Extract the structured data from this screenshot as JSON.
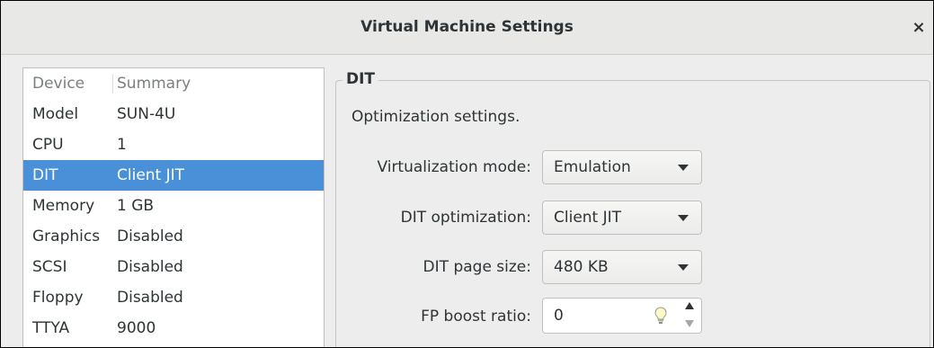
{
  "window": {
    "title": "Virtual Machine Settings",
    "close_glyph": "×"
  },
  "device_list": {
    "headers": {
      "device": "Device",
      "summary": "Summary"
    },
    "rows": [
      {
        "device": "Model",
        "summary": "SUN-4U"
      },
      {
        "device": "CPU",
        "summary": "1"
      },
      {
        "device": "DIT",
        "summary": "Client JIT",
        "selected": true
      },
      {
        "device": "Memory",
        "summary": "1 GB"
      },
      {
        "device": "Graphics",
        "summary": "Disabled"
      },
      {
        "device": "SCSI",
        "summary": "Disabled"
      },
      {
        "device": "Floppy",
        "summary": "Disabled"
      },
      {
        "device": "TTYA",
        "summary": "9000"
      }
    ],
    "selected_color": "#4a90d9"
  },
  "panel": {
    "group_title": "DIT",
    "description": "Optimization settings.",
    "virtualization_mode": {
      "label": "Virtualization mode:",
      "value": "Emulation"
    },
    "dit_optimization": {
      "label": "DIT optimization:",
      "value": "Client JIT"
    },
    "dit_page_size": {
      "label": "DIT page size:",
      "value": "480 KB"
    },
    "fp_boost_ratio": {
      "label": "FP boost ratio:",
      "value": "0",
      "icon": "lightbulb-icon"
    }
  }
}
